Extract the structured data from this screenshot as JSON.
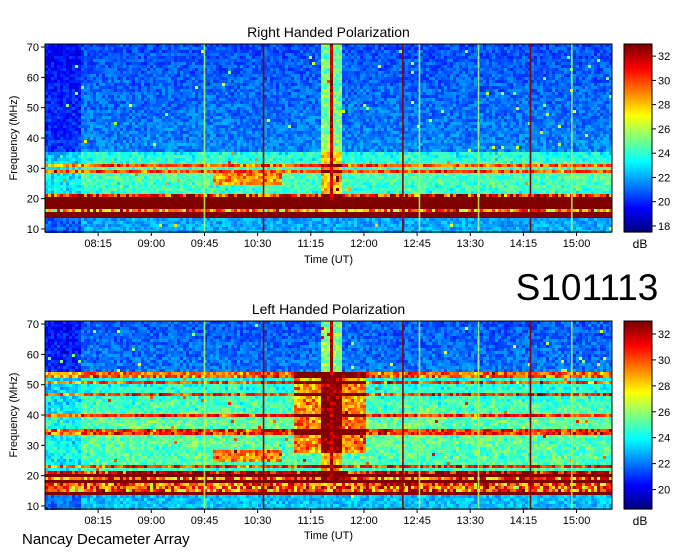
{
  "figure": {
    "station_id": "S101113",
    "footer_label": "Nancay Decameter Array"
  },
  "chart_data": [
    {
      "type": "heatmap",
      "title": "Right Handed Polarization",
      "xlabel": "Time (UT)",
      "ylabel": "Frequency (MHz)",
      "x_ticks": [
        "08:15",
        "09:00",
        "09:45",
        "10:30",
        "11:15",
        "12:00",
        "12:45",
        "13:30",
        "14:15",
        "15:00"
      ],
      "y_ticks": [
        10,
        20,
        30,
        40,
        50,
        60,
        70
      ],
      "ylim": [
        9,
        71
      ],
      "xlim": [
        "07:30",
        "15:30"
      ],
      "colorbar": {
        "label": "dB",
        "ticks": [
          18,
          20,
          22,
          24,
          26,
          28,
          30,
          32
        ],
        "range": [
          17.5,
          33
        ],
        "colormap": "jet"
      },
      "features": {
        "strong_burst": {
          "start": "11:29",
          "end": "11:33",
          "freq_range": [
            19,
            71
          ]
        },
        "interference_lines_dark_red": [
          "10:35",
          "12:33",
          "14:21"
        ],
        "interference_lines_light": [
          "09:45",
          "12:47",
          "13:37",
          "14:56"
        ],
        "emission_band_mhz": [
          21,
          36
        ],
        "low_freq_saturation_mhz": [
          14,
          22
        ]
      }
    },
    {
      "type": "heatmap",
      "title": "Left Handed Polarization",
      "xlabel": "Time (UT)",
      "ylabel": "Frequency (MHz)",
      "x_ticks": [
        "08:15",
        "09:00",
        "09:45",
        "10:30",
        "11:15",
        "12:00",
        "12:45",
        "13:30",
        "14:15",
        "15:00"
      ],
      "y_ticks": [
        10,
        20,
        30,
        40,
        50,
        60,
        70
      ],
      "ylim": [
        9,
        71
      ],
      "xlim": [
        "07:30",
        "15:30"
      ],
      "colorbar": {
        "label": "dB",
        "ticks": [
          20,
          22,
          24,
          26,
          28,
          30,
          32
        ],
        "range": [
          18.5,
          33
        ],
        "colormap": "jet"
      },
      "features": {
        "strong_burst": {
          "start": "11:29",
          "end": "11:33",
          "freq_range": [
            19,
            71
          ]
        },
        "interference_lines_dark_red": [
          "10:35",
          "12:33",
          "14:21"
        ],
        "interference_lines_light": [
          "09:45",
          "12:47",
          "13:37",
          "14:56"
        ],
        "emission_band_mhz": [
          21,
          55
        ],
        "low_freq_saturation_mhz": [
          14,
          22
        ]
      }
    }
  ]
}
